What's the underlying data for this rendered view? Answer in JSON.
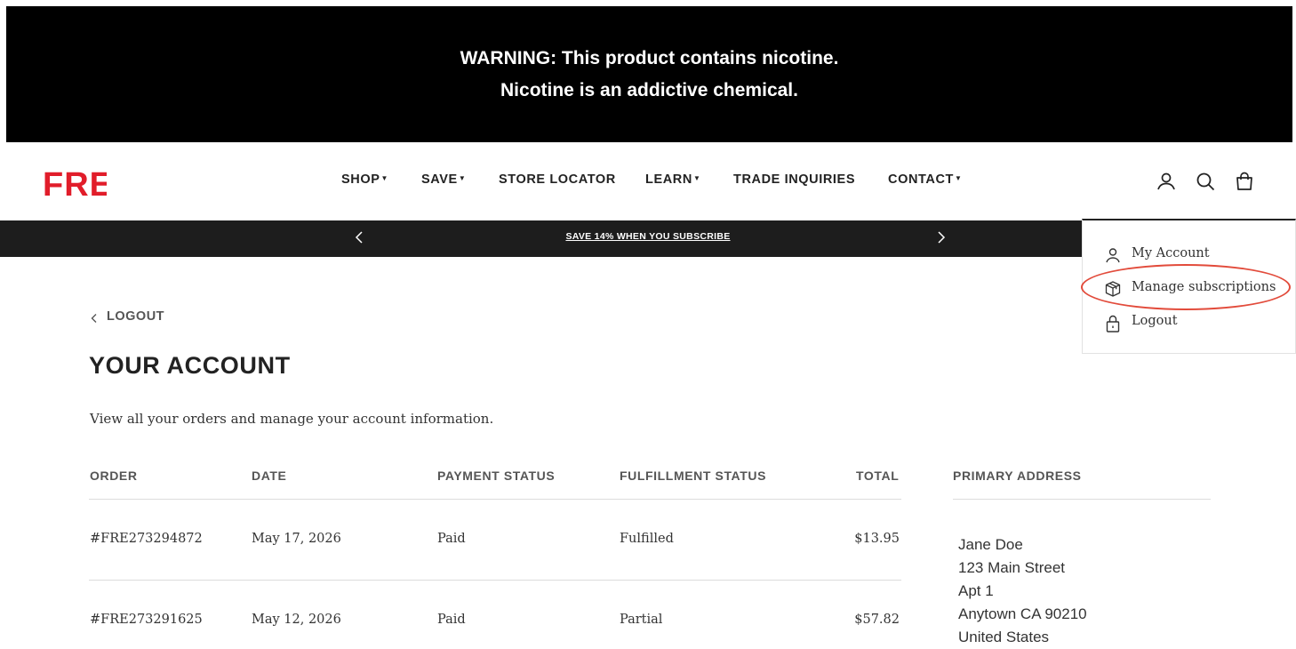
{
  "warning": {
    "line1": "WARNING: This product contains nicotine.",
    "line2": "Nicotine is an addictive chemical."
  },
  "brand": {
    "logo_text": "FRE",
    "color": "#e11d2a"
  },
  "nav": {
    "shop": "SHOP",
    "save": "SAVE",
    "store_locator": "STORE LOCATOR",
    "learn": "LEARN",
    "trade_inquiries": "TRADE INQUIRIES",
    "contact": "CONTACT"
  },
  "header_icons": [
    "user-icon",
    "search-icon",
    "bag-icon"
  ],
  "promo": {
    "text": "SAVE 14% WHEN YOU SUBSCRIBE"
  },
  "account_menu": {
    "my_account": "My Account",
    "manage_subscriptions": "Manage subscriptions",
    "logout": "Logout"
  },
  "account": {
    "back_link": "LOGOUT",
    "title": "YOUR ACCOUNT",
    "subtitle": "View all your orders and manage your account information."
  },
  "orders": {
    "headers": {
      "order": "ORDER",
      "date": "DATE",
      "payment_status": "PAYMENT STATUS",
      "fulfillment_status": "FULFILLMENT STATUS",
      "total": "TOTAL"
    },
    "rows": [
      {
        "order": "#FRE273294872",
        "date": "May 17, 2026",
        "payment": "Paid",
        "fulfillment": "Fulfilled",
        "total": "$13.95"
      },
      {
        "order": "#FRE273291625",
        "date": "May 12, 2026",
        "payment": "Paid",
        "fulfillment": "Partial",
        "total": "$57.82"
      }
    ]
  },
  "primary_address": {
    "heading": "PRIMARY ADDRESS",
    "name": "Jane Doe",
    "street": "123 Main Street",
    "unit": "Apt 1",
    "city_line": "Anytown CA 90210",
    "country": "United States"
  },
  "colors": {
    "banner_bg": "#000000",
    "promo_bg": "#1d1d1d",
    "highlight": "#e24b3b"
  }
}
